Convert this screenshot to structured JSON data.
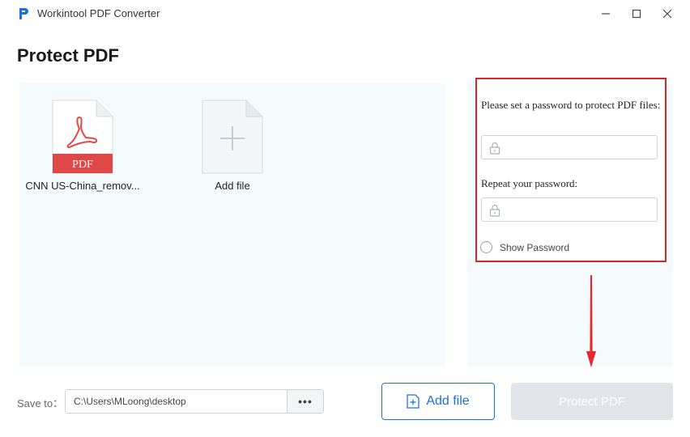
{
  "window": {
    "title": "Workintool PDF Converter",
    "controls": [
      "minimize-icon",
      "maximize-icon",
      "close-icon"
    ]
  },
  "page": {
    "title": "Protect PDF"
  },
  "files": [
    {
      "name": "CNN US-China_remov...",
      "badge": "PDF",
      "icon": "pdf-file-icon"
    },
    {
      "name": "Add file",
      "icon": "add-file-icon"
    }
  ],
  "password_panel": {
    "label_1": "Please set a password to protect PDF files:",
    "input_1_value": "",
    "label_2": "Repeat your password:",
    "input_2_value": "",
    "show_password_label": "Show Password",
    "show_password_checked": false
  },
  "bottom": {
    "save_to_label": "Save to：",
    "save_path": "C:\\Users\\MLoong\\desktop",
    "browse_label": "•••",
    "add_file_label": "Add file",
    "protect_label": "Protect PDF"
  },
  "colors": {
    "accent_blue": "#1e6fd9",
    "pdf_red": "#e04848",
    "highlight_red": "#d9262b",
    "disabled_button": "#e1e4e8"
  }
}
